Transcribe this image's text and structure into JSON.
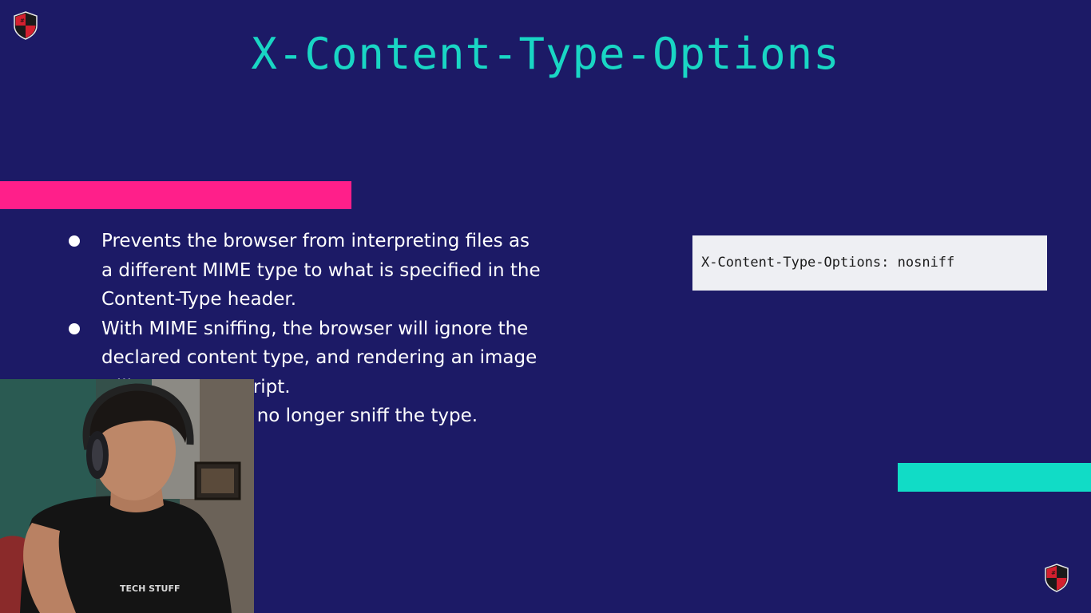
{
  "slide": {
    "title": "X-Content-Type-Options",
    "bullets": [
      "Prevents the browser from interpreting files as a different MIME type to what is specified in the Content-Type header.",
      "With MIME sniffing, the browser will ignore the declared content type, and rendering an image will execute a script.",
      "The browser will no longer sniff the type."
    ],
    "code_snippet": "X-Content-Type-Options: nosniff",
    "colors": {
      "background": "#1c1a66",
      "title": "#19d6c4",
      "pink_bar": "#ff1f8a",
      "teal_bar": "#11dcc6",
      "code_box": "#eeeff3"
    }
  },
  "webcam": {
    "shirt_text": "TECH STUFF"
  },
  "icons": {
    "logo": "shield-logo-icon"
  }
}
